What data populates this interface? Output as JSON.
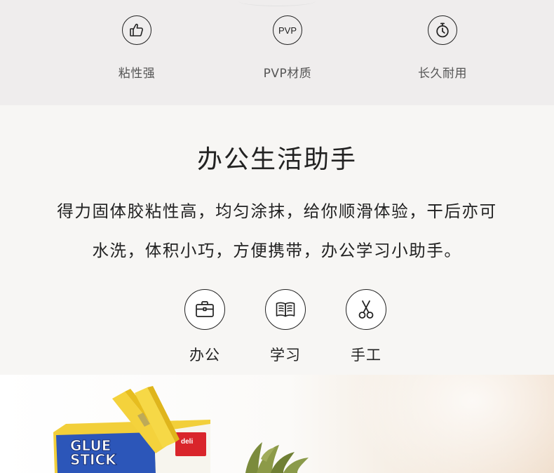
{
  "features": [
    {
      "icon": "thumbs-up-icon",
      "label": "粘性强"
    },
    {
      "icon": "pvp-icon",
      "icon_text": "PVP",
      "label": "PVP材质"
    },
    {
      "icon": "stopwatch-icon",
      "label": "长久耐用"
    }
  ],
  "section": {
    "title": "办公生活助手",
    "desc_line1": "得力固体胶粘性高，均匀涂抹，给你顺滑体验，干后亦可",
    "desc_line2": "水洗，体积小巧，方便携带，办公学习小助手。"
  },
  "uses": [
    {
      "icon": "briefcase-icon",
      "label": "办公"
    },
    {
      "icon": "book-icon",
      "label": "学习"
    },
    {
      "icon": "scissors-icon",
      "label": "手工"
    }
  ],
  "photo": {
    "box_line1": "GLUE",
    "box_line2": "STICK",
    "brand": "deli"
  },
  "colors": {
    "top_band": "#efeded",
    "section_bg": "#f7f6f4",
    "glue_yellow": "#f5d23a",
    "box_blue": "#2350b5",
    "brand_red": "#d9252b"
  }
}
